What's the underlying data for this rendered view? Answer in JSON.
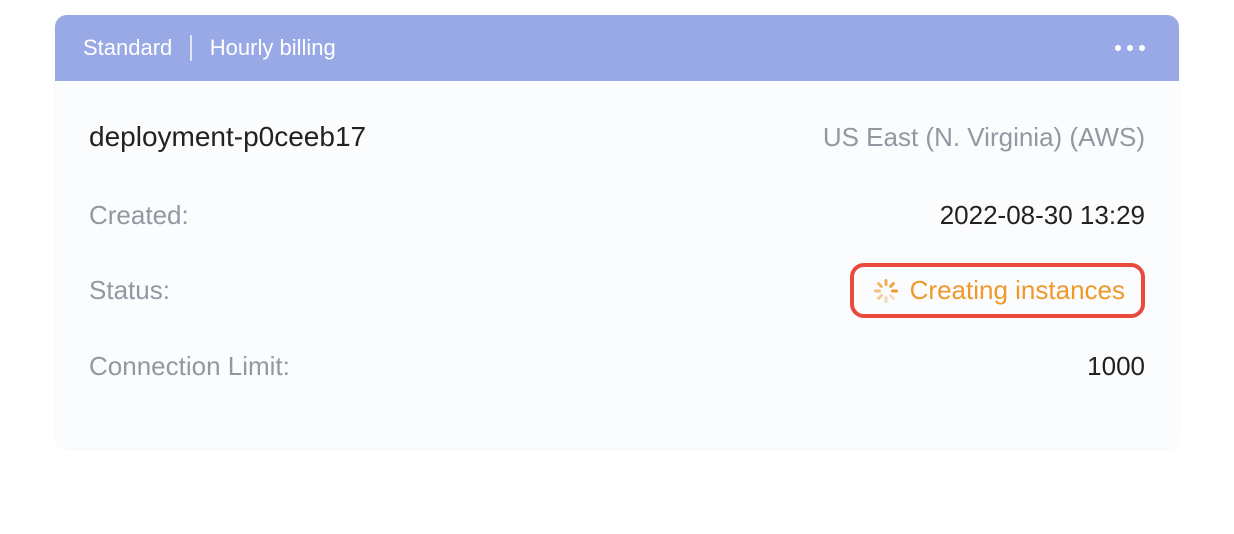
{
  "header": {
    "tier": "Standard",
    "billing": "Hourly billing"
  },
  "deployment": {
    "name": "deployment-p0ceeb17",
    "region": "US East (N. Virginia) (AWS)"
  },
  "details": {
    "created_label": "Created:",
    "created_value": "2022-08-30 13:29",
    "status_label": "Status:",
    "status_value": "Creating instances",
    "connlimit_label": "Connection Limit:",
    "connlimit_value": "1000"
  }
}
